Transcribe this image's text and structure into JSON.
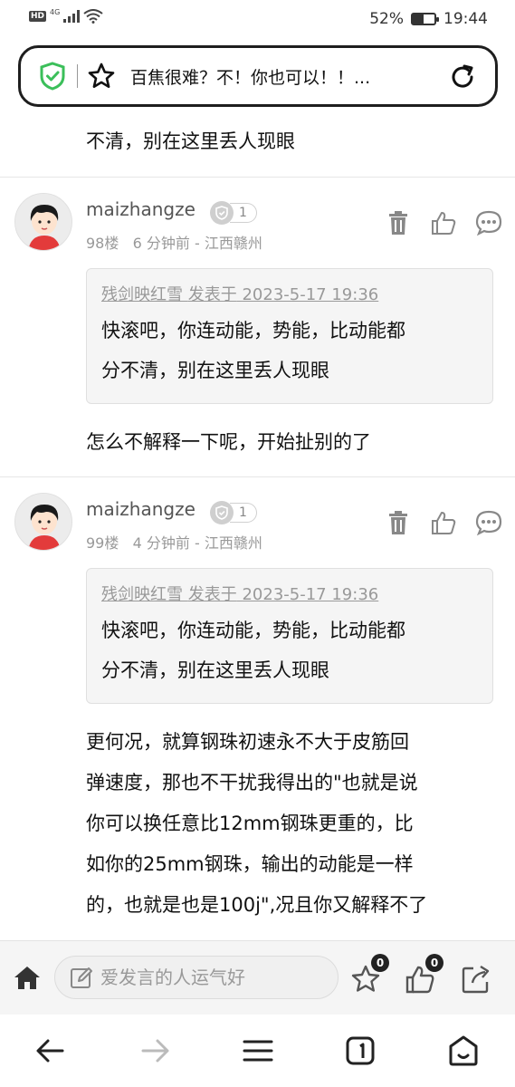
{
  "status_bar": {
    "hd": "HD",
    "network": "4G",
    "battery_percent": "52%",
    "battery_level": 0.52,
    "time": "19:44"
  },
  "address_bar": {
    "title": "百焦很难？不！你也可以！！..."
  },
  "feed": {
    "previous_tail": "不清，别在这里丢人现眼",
    "posts": [
      {
        "username": "maizhangze",
        "level": "1",
        "floor": "98楼",
        "time": "6 分钟前",
        "location": "江西赣州",
        "quote": {
          "author": "残剑映红雪",
          "posted_label": "发表于",
          "date": "2023-5-17 19:36",
          "line1": "快滚吧，你连动能，势能，比动能都",
          "line2": "分不清，别在这里丢人现眼"
        },
        "text_lines": [
          "怎么不解释一下呢，开始扯别的了"
        ]
      },
      {
        "username": "maizhangze",
        "level": "1",
        "floor": "99楼",
        "time": "4 分钟前",
        "location": "江西赣州",
        "quote": {
          "author": "残剑映红雪",
          "posted_label": "发表于",
          "date": "2023-5-17 19:36",
          "line1": "快滚吧，你连动能，势能，比动能都",
          "line2": "分不清，别在这里丢人现眼"
        },
        "text_lines": [
          "更何况，就算钢珠初速永不大于皮筋回",
          "弹速度，那也不干扰我得出的\"也就是说",
          "你可以换任意比12mm钢珠更重的，比",
          "如你的25mm钢珠，输出的动能是一样",
          "的，也就是也是100j\",况且你又解释不了"
        ]
      }
    ]
  },
  "comment_bar": {
    "placeholder": "爱发言的人运气好",
    "favorite_count": "0",
    "like_count": "0"
  },
  "icons": {
    "shield": "shield-check-icon",
    "star": "star-icon",
    "reload": "reload-icon",
    "delete": "trash-icon",
    "like": "thumbs-up-icon",
    "reply": "chat-bubble-icon",
    "home": "home-icon",
    "edit": "pencil-icon",
    "share": "share-icon"
  },
  "colors": {
    "shield_green": "#3bbf5a",
    "text_dark": "#111111",
    "meta_gray": "#999999"
  }
}
